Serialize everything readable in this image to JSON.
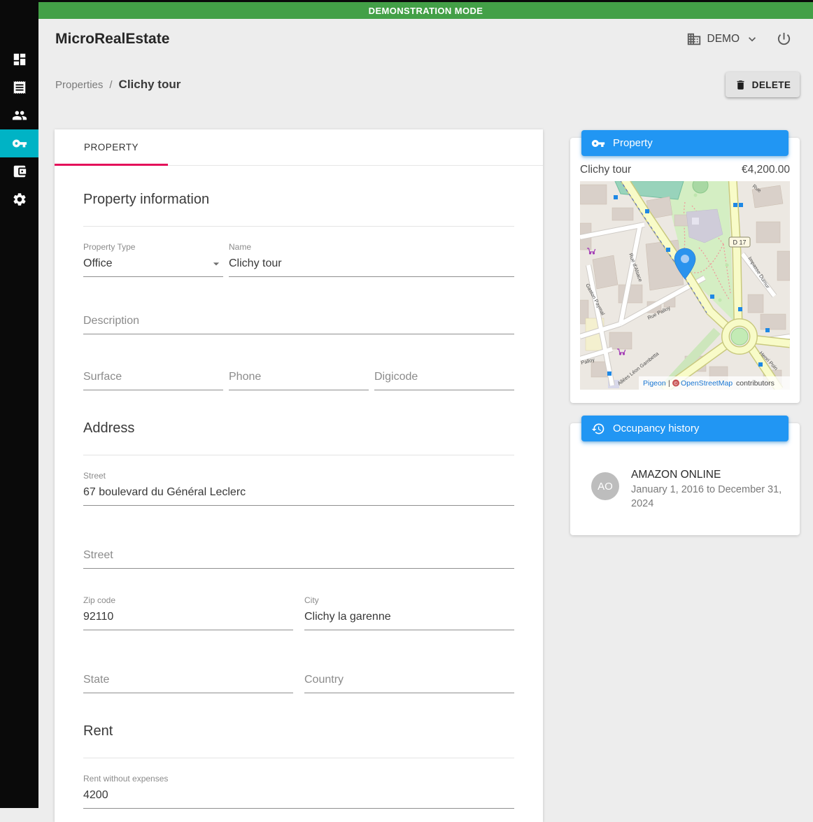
{
  "banner": {
    "text": "DEMONSTRATION MODE"
  },
  "app": {
    "title": "MicroRealEstate"
  },
  "header": {
    "org_label": "DEMO"
  },
  "sidebar": {
    "items": [
      {
        "icon": "dashboard-icon",
        "active": false
      },
      {
        "icon": "rents-receipt-icon",
        "active": false
      },
      {
        "icon": "tenants-people-icon",
        "active": false
      },
      {
        "icon": "properties-key-icon",
        "active": true
      },
      {
        "icon": "accounting-wallet-icon",
        "active": false
      },
      {
        "icon": "settings-gear-icon",
        "active": false
      }
    ]
  },
  "breadcrumb": {
    "parent": "Properties",
    "separator": "/",
    "current": "Clichy tour"
  },
  "toolbar": {
    "delete_label": "DELETE"
  },
  "tabs": [
    {
      "label": "PROPERTY",
      "active": true
    }
  ],
  "form": {
    "property_info": {
      "title": "Property information",
      "property_type": {
        "label": "Property Type",
        "value": "Office"
      },
      "name": {
        "label": "Name",
        "value": "Clichy tour"
      },
      "description": {
        "label": "Description",
        "value": ""
      },
      "surface": {
        "label": "Surface",
        "value": ""
      },
      "phone": {
        "label": "Phone",
        "value": ""
      },
      "digicode": {
        "label": "Digicode",
        "value": ""
      }
    },
    "address": {
      "title": "Address",
      "street1": {
        "label": "Street",
        "value": "67 boulevard du Général Leclerc"
      },
      "street2": {
        "label": "Street",
        "value": ""
      },
      "zip": {
        "label": "Zip code",
        "value": "92110"
      },
      "city": {
        "label": "City",
        "value": "Clichy la garenne"
      },
      "state": {
        "label": "State",
        "value": ""
      },
      "country": {
        "label": "Country",
        "value": ""
      }
    },
    "rent": {
      "title": "Rent",
      "rent_without_expenses": {
        "label": "Rent without expenses",
        "value": "4200"
      }
    }
  },
  "property_card": {
    "header": "Property",
    "name": "Clichy tour",
    "amount": "€4,200.00",
    "map": {
      "road_badge": "D 17",
      "streets": [
        "Rue d'Alsace",
        "Rue Palloy",
        "Allées Léon Gambetta",
        "Gaston Paymal",
        "Impasse Dumur",
        "Henri Poin",
        "Palloy",
        "Rue"
      ],
      "attribution": {
        "provider": "Pigeon",
        "separator": "|",
        "copyright": "©",
        "osm": "OpenStreetMap",
        "suffix": "contributors"
      }
    }
  },
  "occupancy_card": {
    "header": "Occupancy history",
    "tenant": {
      "initials": "AO",
      "name": "AMAZON ONLINE",
      "period": "January 1, 2016 to December 31, 2024"
    }
  },
  "colors": {
    "banner_green": "#43A047",
    "nav_active_cyan": "#00B3C5",
    "chip_blue": "#2196F3",
    "tab_indicator_pink": "#E4105A",
    "pin_blue": "#2A93EE"
  }
}
